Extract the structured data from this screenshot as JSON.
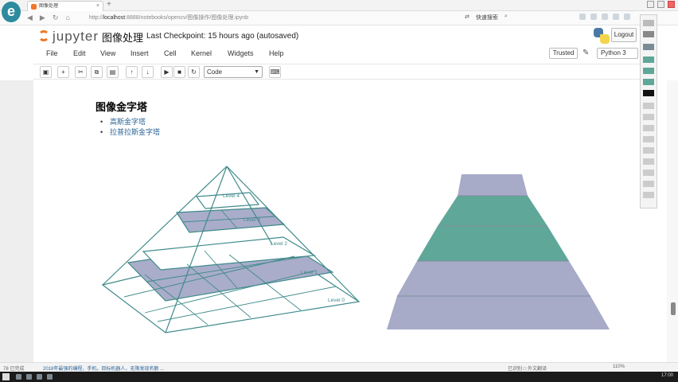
{
  "browser": {
    "tab_title": "图像处理",
    "tab_close": "×",
    "new_tab": "+",
    "url_prefix": "http://",
    "url_host": "localhost",
    "url_rest": ":8888/notebooks/opencv/图像操作/图像处理.ipynb",
    "search_label": "快速搜索",
    "logo_letter": "e"
  },
  "header": {
    "logo_word": "jupyter",
    "notebook_name": "图像处理",
    "checkpoint": "Last Checkpoint: 15 hours ago (autosaved)",
    "logout_label": "Logout"
  },
  "menubar": {
    "items": [
      "File",
      "Edit",
      "View",
      "Insert",
      "Cell",
      "Kernel",
      "Widgets",
      "Help"
    ],
    "trusted_label": "Trusted",
    "kernel_name": "Python 3"
  },
  "toolbar": {
    "buttons": [
      {
        "icon": "save-icon",
        "glyph": "▣"
      },
      {
        "icon": "plus-icon",
        "glyph": "+"
      },
      {
        "icon": "scissors-icon",
        "glyph": "✂"
      },
      {
        "icon": "copy-icon",
        "glyph": "⧉"
      },
      {
        "icon": "paste-icon",
        "glyph": "▤"
      },
      {
        "icon": "arrow-up-icon",
        "glyph": "↑"
      },
      {
        "icon": "arrow-down-icon",
        "glyph": "↓"
      },
      {
        "icon": "run-icon",
        "glyph": "▶"
      },
      {
        "icon": "stop-icon",
        "glyph": "■"
      },
      {
        "icon": "restart-icon",
        "glyph": "↻"
      },
      {
        "icon": "keyboard-icon",
        "glyph": "⌨"
      }
    ],
    "cell_type": "Code"
  },
  "notebook": {
    "heading": "图像金字塔",
    "list_items": [
      "高斯金字塔",
      "拉普拉斯金字塔"
    ]
  },
  "figure": {
    "level_labels": [
      "Level 4",
      "Level 3",
      "Level 2",
      "Level 1",
      "Level 0"
    ],
    "colors": {
      "grid_stroke": "#3f8a8a",
      "plane_fill": "#a9adc9",
      "teal_fill": "#5fa798",
      "lavender_fill": "#a7abc8"
    }
  },
  "statusbar": {
    "left": "78 已完成",
    "link": "2018年最强的编程，手机，目标机器人，无限发现名额 ...",
    "mid": "已识别   □ 外文翻译",
    "zoom": "110%"
  },
  "taskbar": {
    "clock": "17:00"
  }
}
